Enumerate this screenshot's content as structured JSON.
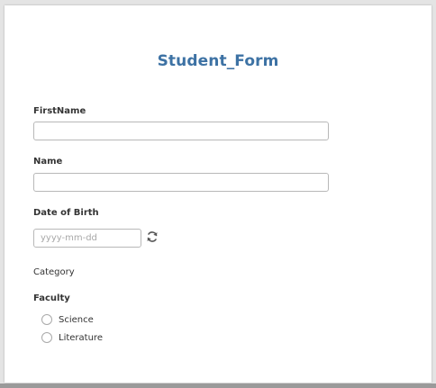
{
  "form": {
    "title": "Student_Form",
    "fields": {
      "firstname": {
        "label": "FirstName",
        "value": ""
      },
      "name": {
        "label": "Name",
        "value": ""
      },
      "dob": {
        "label": "Date of Birth",
        "placeholder": "yyyy-mm-dd",
        "value": ""
      }
    },
    "category": {
      "label": "Category"
    },
    "faculty": {
      "label": "Faculty",
      "options": [
        {
          "label": "Science",
          "selected": false
        },
        {
          "label": "Literature",
          "selected": false
        }
      ]
    }
  },
  "colors": {
    "title": "#3d72a4",
    "input_border": "#b8b8b8",
    "background": "#e4e4e4"
  },
  "icons": {
    "date_refresh": "refresh-icon"
  }
}
